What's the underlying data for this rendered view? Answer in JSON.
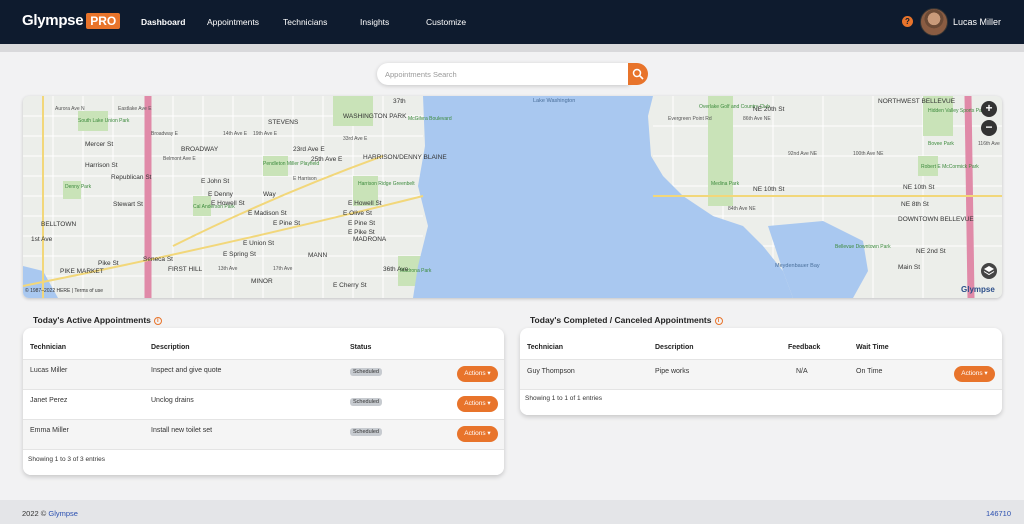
{
  "app": {
    "logo_text": "Glympse",
    "logo_badge": "PRO"
  },
  "nav": {
    "items": [
      {
        "label": "Dashboard",
        "active": true
      },
      {
        "label": "Appointments",
        "active": false
      },
      {
        "label": "Technicians",
        "active": false
      },
      {
        "label": "Insights",
        "active": false
      },
      {
        "label": "Customize",
        "active": false
      }
    ],
    "help_icon": "?",
    "user_name": "Lucas Miller"
  },
  "search": {
    "placeholder": "Appointments Search",
    "icon": "search-icon"
  },
  "map": {
    "labels": {
      "lake": "Lake Washington",
      "madronna": "MADRONA",
      "broadway": "BROADWAY",
      "stevens": "STEVENS",
      "washington_park": "WASHINGTON PARK",
      "harrison": "HARRISON/DENNY BLAINE",
      "beltown": "BELLTOWN",
      "first_hill": "FIRST HILL",
      "minor": "MINOR",
      "mann": "MANN",
      "pike_market": "PIKE MARKET",
      "south_lake_union": "South Lake Union Park",
      "denny_park": "Denny Park",
      "cal_anderson": "Cal Anderson Park",
      "pendleton": "Pendleton Miller Playfield",
      "harrison_ridge": "Harrison Ridge Greenbelt",
      "mcgilvra": "McGilvra Boulevard",
      "madrona_park": "Madrona Park",
      "overlake": "Overlake Golf and Country Club",
      "medina_park": "Medina Park",
      "meydenbauer": "Meydenbauer Bay",
      "bellevue_downtown_park": "Bellevue Downtown Park",
      "north_bellevue": "NORTHWEST BELLEVUE",
      "hidden_valley": "Hidden Valley Sports Park",
      "bovee": "Bovee Park",
      "robert_mccormick": "Robert E McCormick Park",
      "downtown_bellevue": "DOWNTOWN BELLEVUE",
      "mercer": "Mercer St",
      "harrison_st": "Harrison St",
      "republican": "Republican St",
      "e_john": "E John St",
      "e_denny": "E Denny",
      "way": "Way",
      "e_howell": "E Howell St",
      "e_madison": "E Madison St",
      "e_pine": "E Pine St",
      "e_union": "E Union St",
      "e_spring": "E Spring St",
      "e_cherry": "E Cherry St",
      "pike_st": "Pike St",
      "seneca": "Seneca St",
      "stewart": "Stewart St",
      "first_ave": "1st Ave",
      "e_olive": "E Olive St",
      "e_pike": "E Pike St",
      "ave_23": "23rd Ave E",
      "ave_25": "25th Ave E",
      "ave_36": "36th Ave",
      "ave_37": "37th",
      "ne_20th": "NE 20th St",
      "ne_10th": "NE 10th St",
      "ne_10th_2": "NE 10th St",
      "ne_8th": "NE 8th St",
      "ne_2nd": "NE 2nd St",
      "main_st": "Main St",
      "evergreen": "Evergreen Point Rd",
      "ave_84": "84th Ave NE",
      "ave_86": "86th Ave NE",
      "ave_92": "92nd Ave NE",
      "ave_100": "100th Ave NE",
      "ave_116": "116th Ave",
      "broadway_e": "Broadway E",
      "belmont": "Belmont Ave E",
      "eastlake": "Eastlake Ave E",
      "aurora": "Aurora Ave N",
      "ave_14": "14th Ave E",
      "ave_19": "19th Ave E",
      "ave_13": "13th Ave",
      "ave_17": "17th Ave",
      "e_harrison": "E Harrison",
      "ave_33": "33rd Ave E",
      "e_pine_2": "E Pine St"
    },
    "copyright": "© 1987–2022 HERE | Terms of use",
    "watermark": "Glympse",
    "zoom_in": "+",
    "zoom_out": "−",
    "layers_icon": "layers-icon"
  },
  "active": {
    "title": "Today's Active Appointments",
    "columns": [
      "Technician",
      "Description",
      "Status"
    ],
    "rows": [
      {
        "technician": "Lucas Miller",
        "description": "Inspect and give quote",
        "status": "Scheduled",
        "action": "Actions ▾"
      },
      {
        "technician": "Janet Perez",
        "description": "Unclog drains",
        "status": "Scheduled",
        "action": "Actions ▾"
      },
      {
        "technician": "Emma Miller",
        "description": "Install new toilet set",
        "status": "Scheduled",
        "action": "Actions ▾"
      }
    ],
    "footer": "Showing 1 to 3 of 3 entries"
  },
  "completed": {
    "title": "Today's Completed / Canceled Appointments",
    "columns": [
      "Technician",
      "Description",
      "Feedback",
      "Wait Time"
    ],
    "rows": [
      {
        "technician": "Guy Thompson",
        "description": "Pipe works",
        "feedback": "N/A",
        "wait_time": "On Time",
        "action": "Actions ▾"
      }
    ],
    "footer": "Showing 1 to 1 of 1 entries"
  },
  "footer": {
    "year": "2022 ©",
    "brand": "Glympse",
    "build": "146710"
  }
}
